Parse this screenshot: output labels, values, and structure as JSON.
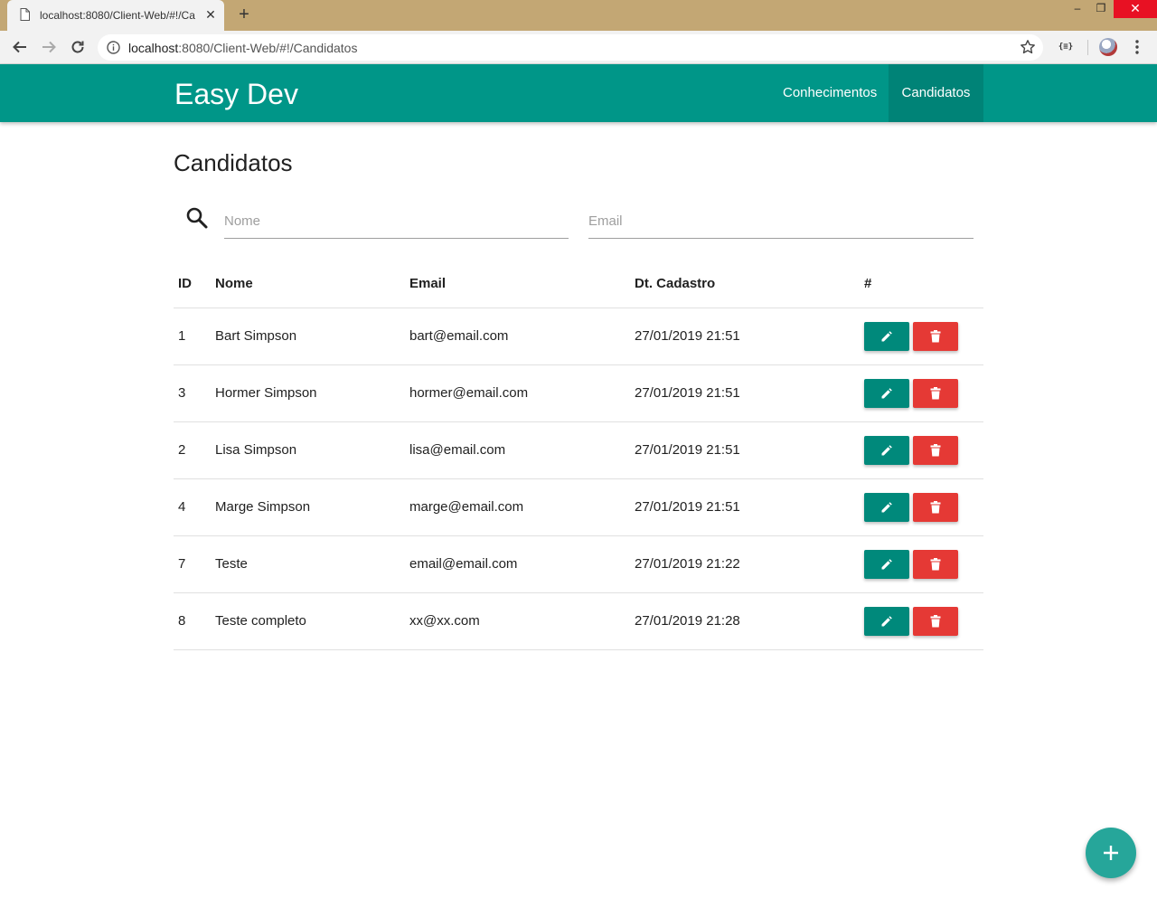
{
  "browser": {
    "tab_title": "localhost:8080/Client-Web/#!/Ca",
    "tab_close": "✕",
    "new_tab": "+",
    "url_host": "localhost",
    "url_path": ":8080/Client-Web/#!/Candidatos",
    "extension_label": "{≡}",
    "window_min": "–",
    "window_max": "❐",
    "window_close": "✕"
  },
  "navbar": {
    "brand": "Easy Dev",
    "items": [
      {
        "label": "Conhecimentos",
        "active": false
      },
      {
        "label": "Candidatos",
        "active": true
      }
    ]
  },
  "page": {
    "title": "Candidatos"
  },
  "search": {
    "nome_placeholder": "Nome",
    "email_placeholder": "Email"
  },
  "table": {
    "headers": [
      "ID",
      "Nome",
      "Email",
      "Dt. Cadastro",
      "#"
    ],
    "rows": [
      {
        "id": "1",
        "nome": "Bart Simpson",
        "email": "bart@email.com",
        "dt": "27/01/2019 21:51"
      },
      {
        "id": "3",
        "nome": "Hormer Simpson",
        "email": "hormer@email.com",
        "dt": "27/01/2019 21:51"
      },
      {
        "id": "2",
        "nome": "Lisa Simpson",
        "email": "lisa@email.com",
        "dt": "27/01/2019 21:51"
      },
      {
        "id": "4",
        "nome": "Marge Simpson",
        "email": "marge@email.com",
        "dt": "27/01/2019 21:51"
      },
      {
        "id": "7",
        "nome": "Teste",
        "email": "email@email.com",
        "dt": "27/01/2019 21:22"
      },
      {
        "id": "8",
        "nome": "Teste completo",
        "email": "xx@xx.com",
        "dt": "27/01/2019 21:28"
      }
    ]
  },
  "colors": {
    "navbar": "#009688",
    "edit_button": "#00897b",
    "delete_button": "#e53935",
    "fab": "#26a69a",
    "titlebar": "#c3a774"
  },
  "icons": {
    "row_edit": "pencil-icon",
    "row_delete": "trash-icon",
    "fab": "plus-icon",
    "search": "search-icon"
  }
}
